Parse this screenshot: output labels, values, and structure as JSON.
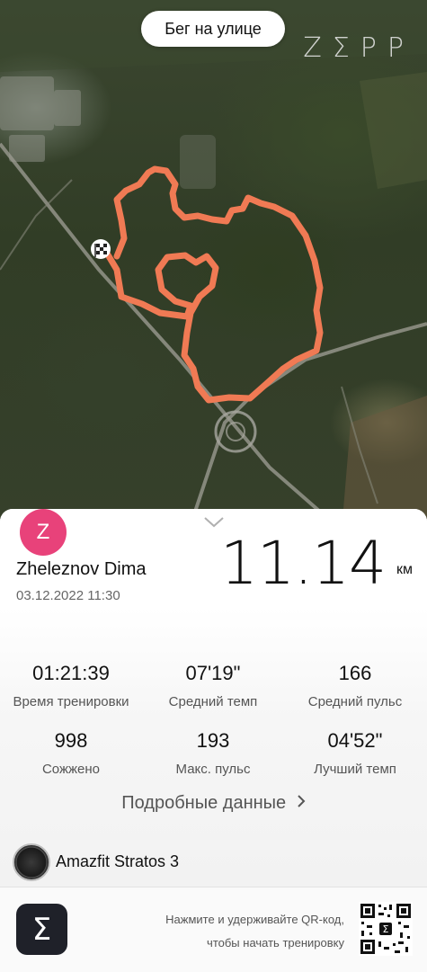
{
  "header": {
    "activity_type": "Бег на улице",
    "brand_logo": "ZΣPP"
  },
  "map": {
    "route_color": "#f07a54",
    "finish_icon": "checkered-flag-icon"
  },
  "summary": {
    "avatar_letter": "Z",
    "avatar_color": "#e8427a",
    "user_name": "Zheleznov Dima",
    "datetime": "03.12.2022 11:30",
    "distance": "11.14",
    "distance_unit": "км",
    "collapse_icon": "chevron-down-icon"
  },
  "stats": [
    {
      "value": "01:21:39",
      "label": "Время тренировки"
    },
    {
      "value": "07'19\"",
      "label": "Средний темп"
    },
    {
      "value": "166",
      "label": "Средний пульс"
    },
    {
      "value": "998",
      "label": "Сожжено"
    },
    {
      "value": "193",
      "label": "Макс. пульс"
    },
    {
      "value": "04'52\"",
      "label": "Лучший темп"
    }
  ],
  "details_link": "Подробные данные",
  "device": {
    "name": "Amazfit Stratos 3",
    "icon": "watch-icon"
  },
  "footer": {
    "app_icon_glyph": "Σ",
    "hint_line1": "Нажмите и удерживайте QR-код,",
    "hint_line2": "чтобы начать тренировку",
    "qr_icon": "qr-code-icon"
  }
}
